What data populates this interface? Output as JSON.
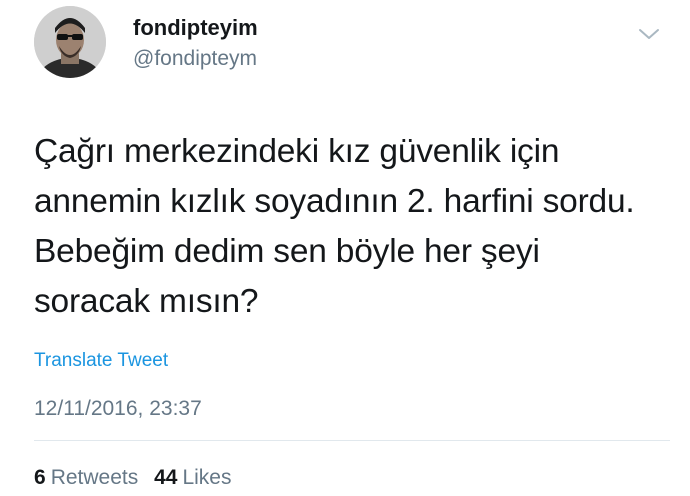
{
  "user": {
    "display_name": "fondipteyim",
    "handle": "@fondipteym"
  },
  "tweet": {
    "lines": [
      "Çağrı merkezindeki kız güvenlik için",
      "annemin kızlık soyadının 2. harfini sordu.",
      "Bebeğim dedim sen böyle her şeyi",
      "soracak mısın?"
    ],
    "translate_label": "Translate Tweet",
    "timestamp": "12/11/2016, 23:37"
  },
  "stats": {
    "retweets_count": "6",
    "retweets_label": "Retweets",
    "likes_count": "44",
    "likes_label": "Likes"
  },
  "icons": {
    "menu": "chevron-down-icon",
    "avatar": "profile-photo"
  },
  "colors": {
    "link": "#1b95e0",
    "secondary_text": "#657786",
    "primary_text": "#14171a",
    "divider": "#e1e8ed"
  }
}
